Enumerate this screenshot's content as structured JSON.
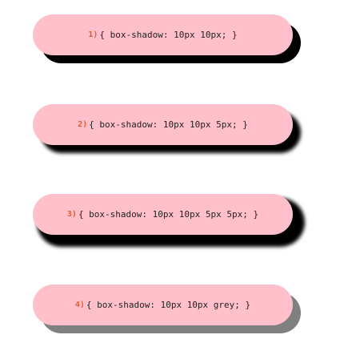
{
  "examples": [
    {
      "number": "1)",
      "code": "{ box-shadow: 10px 10px; }"
    },
    {
      "number": "2)",
      "code": "{ box-shadow: 10px 10px 5px; }"
    },
    {
      "number": "3)",
      "code": "{ box-shadow: 10px 10px 5px 5px; }"
    },
    {
      "number": "4)",
      "code": "{ box-shadow: 10px 10px grey; }"
    }
  ],
  "colors": {
    "pill_background": "#ffc0cb",
    "number_accent": "#e05a30",
    "shadow_black": "#000000",
    "shadow_grey": "#808080"
  }
}
